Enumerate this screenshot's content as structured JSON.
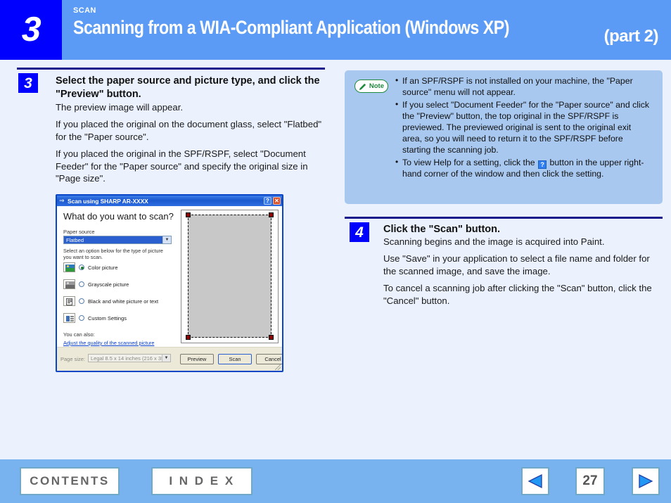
{
  "header": {
    "chapter_number": "3",
    "kicker": "SCAN",
    "title": "Scanning from a WIA-Compliant Application (Windows XP)",
    "part": "(part 2)"
  },
  "steps": [
    {
      "number": "3",
      "title": "Select the paper source and picture type, and click the \"Preview\" button.",
      "paragraphs": [
        "The preview image will appear.",
        "If you placed the original on the document glass, select \"Flatbed\" for the \"Paper source\".",
        "If you placed the original in the SPF/RSPF, select \"Document Feeder\" for the \"Paper source\" and specify the original size in \"Page size\"."
      ]
    },
    {
      "number": "4",
      "title": "Click the \"Scan\" button.",
      "paragraphs": [
        "Scanning begins and the image is acquired into Paint.",
        "Use \"Save\" in your application to select a file name and folder for the scanned image, and save the image.",
        "To cancel a scanning job after clicking the \"Scan\" button, click the \"Cancel\" button."
      ]
    }
  ],
  "note": {
    "badge_label": "Note",
    "items": [
      "If an SPF/RSPF is not installed on your machine, the \"Paper source\" menu will not appear.",
      "If you select \"Document Feeder\" for the \"Paper source\" and click the \"Preview\" button, the top original in the SPF/RSPF is previewed. The previewed original is sent to the original exit area, so you will need to return it to the SPF/RSPF before starting the scanning job."
    ],
    "help_item": {
      "before": "To view Help for a setting, click the",
      "icon": "?",
      "after": "button in the upper right-hand corner of the window and then click the setting."
    }
  },
  "dialog": {
    "title": "Scan using SHARP AR-XXXX",
    "title_icon": "scanner-icon",
    "help_button": "?",
    "close_button": "✕",
    "heading": "What do you want to scan?",
    "paper_source_label": "Paper source",
    "paper_source_value": "Flatbed",
    "instruction": "Select an option below for the type of picture you want to scan.",
    "options": [
      {
        "label": "Color picture",
        "selected": true,
        "icon": "color-photo-icon"
      },
      {
        "label": "Grayscale picture",
        "selected": false,
        "icon": "grayscale-photo-icon"
      },
      {
        "label": "Black and white picture or text",
        "selected": false,
        "icon": "bw-text-icon"
      },
      {
        "label": "Custom Settings",
        "selected": false,
        "icon": "custom-settings-icon"
      }
    ],
    "you_can_also": "You can also:",
    "adjust_link": "Adjust the quality of the scanned picture",
    "page_size_label": "Page size:",
    "page_size_value": "Legal 8.5 x 14 inches (216 x 356",
    "buttons": {
      "preview": "Preview",
      "scan": "Scan",
      "cancel": "Cancel"
    }
  },
  "footer": {
    "contents": "CONTENTS",
    "index": "I N D E X",
    "prev_icon": "prev-arrow-icon",
    "next_icon": "next-arrow-icon",
    "page_number": "27"
  },
  "colors": {
    "chapter_blue": "#0000ff",
    "header_blue": "#5b9bf5",
    "page_bg": "#ebf2fd",
    "note_bg": "#a8c8f0",
    "note_green": "#1e8a3c",
    "footer_blue": "#79b3ef",
    "rule_navy": "#1a1a8c"
  }
}
